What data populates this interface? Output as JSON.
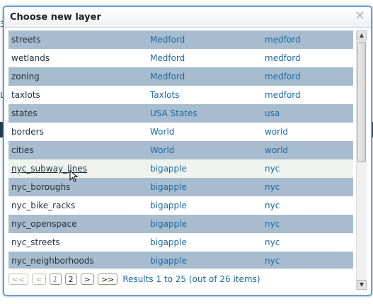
{
  "dialog": {
    "title": "Choose new layer",
    "close_glyph": "✕"
  },
  "layers": [
    {
      "name": "streets",
      "store": "Medford",
      "workspace": "medford"
    },
    {
      "name": "wetlands",
      "store": "Medford",
      "workspace": "medford"
    },
    {
      "name": "zoning",
      "store": "Medford",
      "workspace": "medford"
    },
    {
      "name": "taxlots",
      "store": "Taxlots",
      "workspace": "medford"
    },
    {
      "name": "states",
      "store": "USA States",
      "workspace": "usa"
    },
    {
      "name": "borders",
      "store": "World",
      "workspace": "world"
    },
    {
      "name": "cities",
      "store": "World",
      "workspace": "world"
    },
    {
      "name": "nyc_subway_lines",
      "store": "bigapple",
      "workspace": "nyc"
    },
    {
      "name": "nyc_boroughs",
      "store": "bigapple",
      "workspace": "nyc"
    },
    {
      "name": "nyc_bike_racks",
      "store": "bigapple",
      "workspace": "nyc"
    },
    {
      "name": "nyc_openspace",
      "store": "bigapple",
      "workspace": "nyc"
    },
    {
      "name": "nyc_streets",
      "store": "bigapple",
      "workspace": "nyc"
    },
    {
      "name": "nyc_neighborhoods",
      "store": "bigapple",
      "workspace": "nyc"
    }
  ],
  "hover_index": 7,
  "pager": {
    "first": "<<",
    "prev": "<",
    "page1": "1",
    "page2": "2",
    "next": ">",
    "last": ">>",
    "results": "Results 1 to 25 (out of 26 items)"
  },
  "background_fragments": [
    "3",
    "La"
  ],
  "icons": {
    "scroll_up": "scroll-up-arrow-icon",
    "scroll_down": "scroll-down-arrow-icon",
    "cursor": "mouse-pointer-icon"
  }
}
